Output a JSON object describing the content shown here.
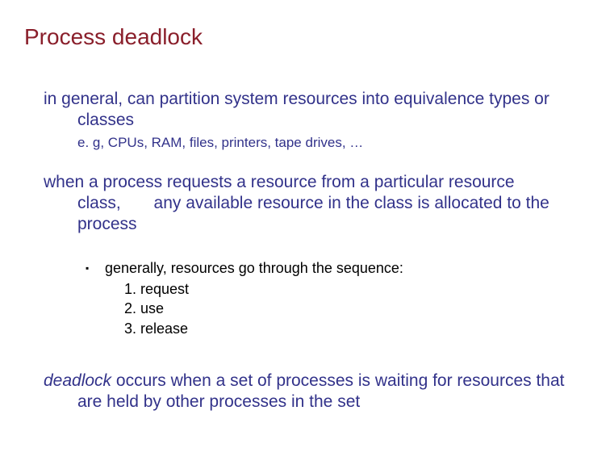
{
  "title": "Process deadlock",
  "para1": "in general, can partition system resources into equivalence types or classes",
  "sub1": "e. g, CPUs, RAM, files, printers, tape drives, …",
  "para2_a": "when a process requests a resource from a particular resource class,",
  "para2_b": "any available resource in the class is allocated to the process",
  "bullet_lead": "generally, resources go through the sequence:",
  "steps": {
    "s1": "1.  request",
    "s2": "2.  use",
    "s3": "3.  release"
  },
  "para3_em": "deadlock",
  "para3_rest": " occurs when a set of processes is waiting for resources that are held by other processes in the set"
}
